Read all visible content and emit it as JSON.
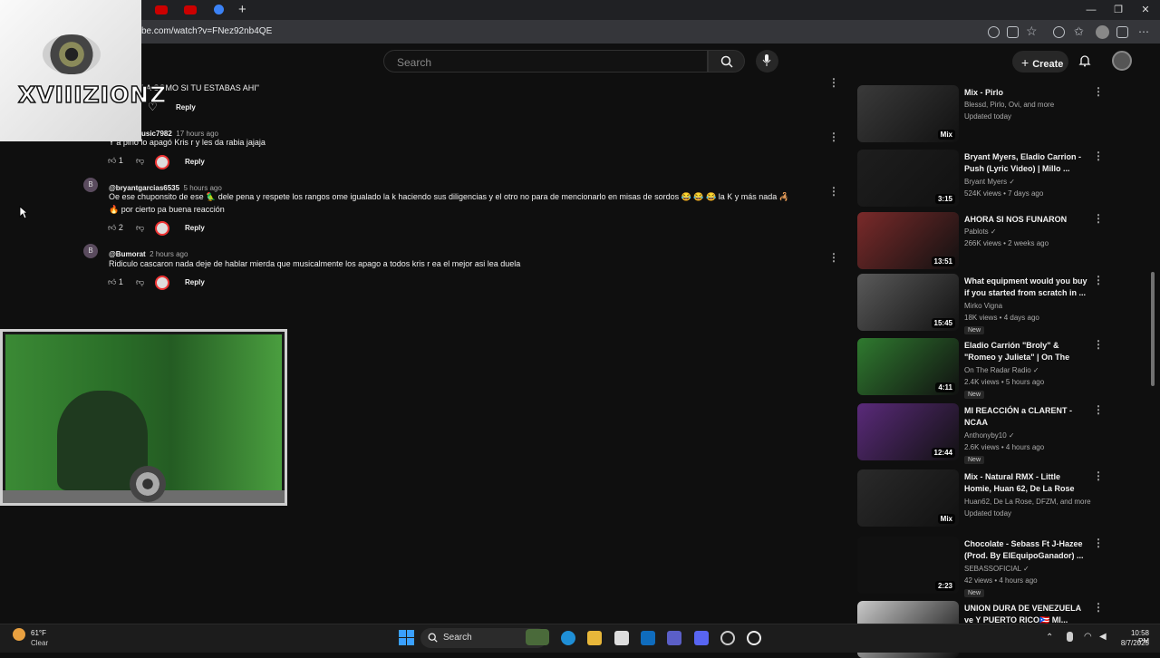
{
  "browser": {
    "url": "be.com/watch?v=FNez92nb4QE",
    "window_buttons": [
      "—",
      "❐",
      "✕"
    ],
    "new_tab": "+"
  },
  "youtube": {
    "search_placeholder": "Search",
    "create_label": "Create",
    "plus": "+"
  },
  "overlay": {
    "logo_text": "XVIIIZIONZ"
  },
  "comments": {
    "top_partial_text": "LA COMO SI TU ESTABAS AHI\"",
    "reply_label": "Reply",
    "items": [
      {
        "handle": "usic7982",
        "time": "17 hours ago",
        "text": "Y a pino lo apagó Kris r y les da rabia jajaja",
        "likes": "1",
        "avatar": ""
      },
      {
        "handle": "@bryantgarcias6535",
        "time": "5 hours ago",
        "text": "Oe ese chuponsito de ese 🦜 dele pena y respete los rangos ome igualado la k haciendo sus diligencias y el otro no para de mencionarlo en misas de sordos 😂 😂 😂 la K y más nada 🦂",
        "text2": "🔥 por cierto pa buena reacción",
        "likes": "2",
        "avatar": "B"
      },
      {
        "handle": "@Bumorat",
        "time": "2 hours ago",
        "text": "Ridiculo cascaron nada deje de hablar mierda que musicalmente los apago a todos kris r ea el mejor asi lea duela",
        "likes": "1",
        "avatar": "B"
      }
    ]
  },
  "sidebar": {
    "videos": [
      {
        "title": "Mix - Pirlo",
        "channel": "Blessd, Pirlo, Ovi, and more",
        "stats": "Updated today",
        "duration": "Mix",
        "badge": "",
        "thumb": "#3a3a3a"
      },
      {
        "title": "Bryant Myers, Eladio Carrion - Push (Lyric Video) | Millo ...",
        "channel": "Bryant Myers ✓",
        "stats": "524K views • 7 days ago",
        "duration": "3:15",
        "badge": "",
        "thumb": "#1e1e1e"
      },
      {
        "title": "AHORA SI NOS FUNARON",
        "channel": "Pablots ✓",
        "stats": "266K views • 2 weeks ago",
        "duration": "13:51",
        "badge": "",
        "thumb": "#7a2a2a"
      },
      {
        "title": "What equipment would you buy if you started from scratch in ...",
        "channel": "Mirko Vigna",
        "stats": "18K views • 4 days ago",
        "duration": "15:45",
        "badge": "New",
        "thumb": "#5a5a5a"
      },
      {
        "title": "Eladio Carrión \"Broly\" & \"Romeo y Julieta\" | On The Radar ...",
        "channel": "On The Radar Radio ✓",
        "stats": "2.4K views • 5 hours ago",
        "duration": "4:11",
        "badge": "New",
        "thumb": "#2f7a2f"
      },
      {
        "title": "MI REACCIÓN a CLARENT - NCAA",
        "channel": "Anthonyby10 ✓",
        "stats": "2.6K views • 4 hours ago",
        "duration": "12:44",
        "badge": "New",
        "thumb": "#5a2a7a"
      },
      {
        "title": "Mix - Natural RMX - Little Homie, Huan 62, De La Rose &...",
        "channel": "Huan62, De La Rose, DFZM, and more",
        "stats": "Updated today",
        "duration": "Mix",
        "badge": "",
        "thumb": "#2a2a2a"
      },
      {
        "title": "Chocolate - Sebass Ft J-Hazee (Prod. By ElEquipoGanador) ...",
        "channel": "SEBASSOFICIAL ✓",
        "stats": "42 views • 4 hours ago",
        "duration": "2:23",
        "badge": "New",
        "thumb": "#111111"
      },
      {
        "title": "UNION DURA DE VENEZUELA ve Y PUERTO RICO🇵🇷 MI...",
        "channel": "",
        "stats": "",
        "duration": "",
        "badge": "",
        "thumb": "#c9c9c9"
      }
    ]
  },
  "taskbar": {
    "weather_temp": "61°F",
    "weather_desc": "Clear",
    "search_label": "Search",
    "time": "10:58 PM",
    "date": "8/7/2025"
  }
}
